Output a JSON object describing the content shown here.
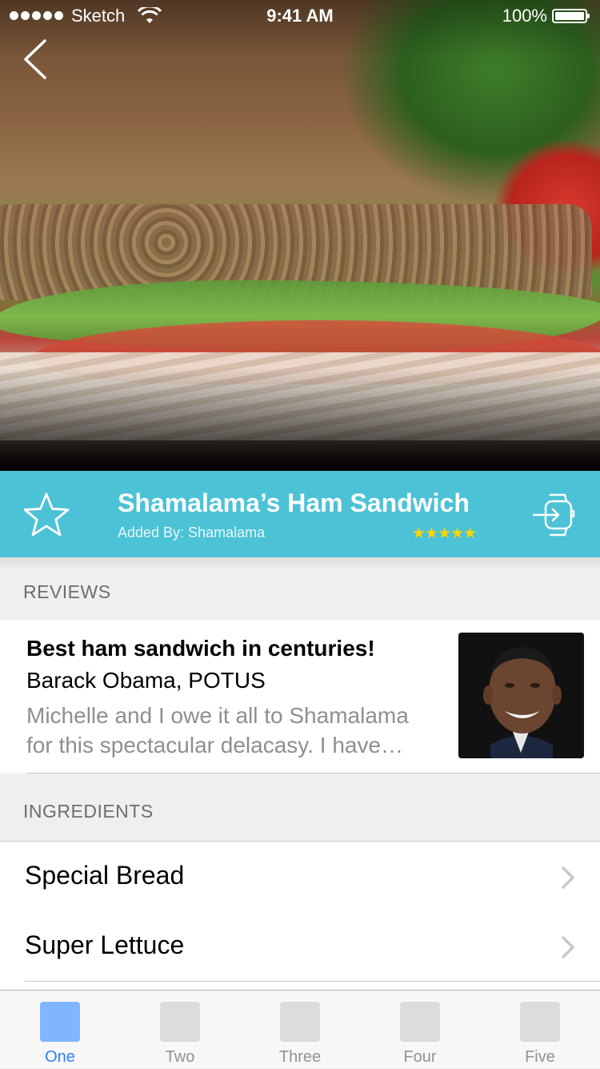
{
  "status_bar": {
    "carrier": "Sketch",
    "time": "9:41 AM",
    "battery": "100%"
  },
  "recipe": {
    "title": "Shamalama’s Ham Sandwich",
    "added_by": "Added By: Shamalama",
    "rating_stars": "★★★★★",
    "rating_value": 5,
    "accent_color": "#4cc2d6",
    "star_color": "#ffd400"
  },
  "reviews": {
    "header": "REVIEWS",
    "items": [
      {
        "title": "Best ham sandwich in centuries!",
        "author": "Barack Obama, POTUS",
        "body_line1": "Michelle and I owe it all to Shamalama",
        "body_line2": "for this spectacular delacasy. I have…"
      }
    ]
  },
  "ingredients": {
    "header": "INGREDIENTS",
    "items": [
      {
        "label": "Special Bread"
      },
      {
        "label": "Super Lettuce"
      }
    ]
  },
  "tab_bar": {
    "active_color": "#2d7ff9",
    "tabs": [
      {
        "label": "One"
      },
      {
        "label": "Two"
      },
      {
        "label": "Three"
      },
      {
        "label": "Four"
      },
      {
        "label": "Five"
      }
    ]
  },
  "icons": {
    "back": "chevron-left-icon",
    "favorite": "star-outline-icon",
    "watch": "watch-send-icon",
    "disclosure": "chevron-right-icon"
  }
}
